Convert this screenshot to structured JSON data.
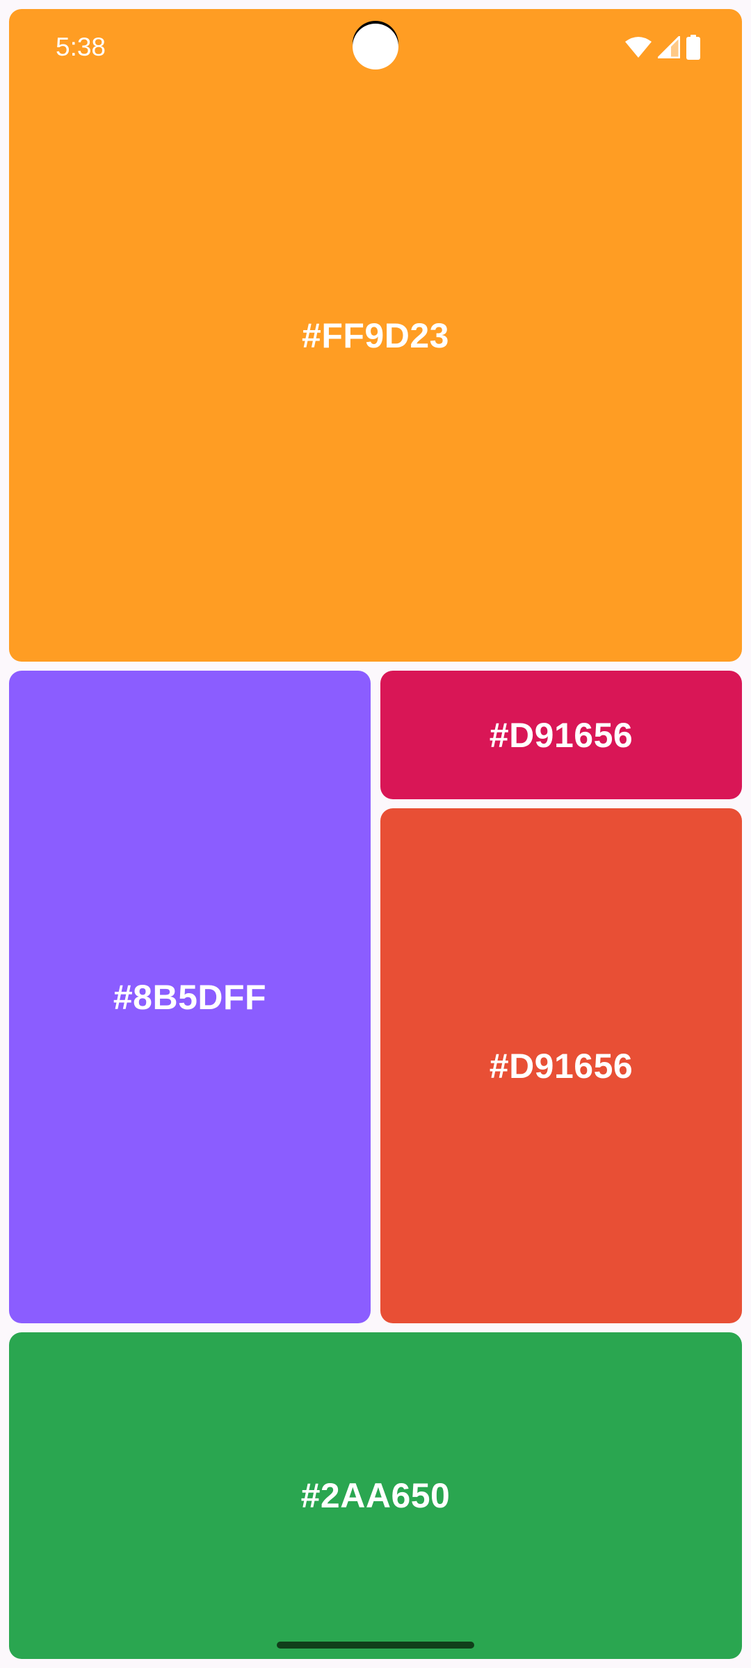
{
  "status_bar": {
    "time": "5:38",
    "icons": [
      "wifi-icon",
      "cellular-signal-icon",
      "battery-icon"
    ]
  },
  "tiles": [
    {
      "label": "#FF9D23",
      "color": "#FF9D23"
    },
    {
      "label": "#8B5DFF",
      "color": "#8B5DFF"
    },
    {
      "label": "#D91656",
      "color": "#D91656"
    },
    {
      "label": "#D91656",
      "color": "#E84F35"
    },
    {
      "label": "#2AA650",
      "color": "#2AA650"
    }
  ],
  "colors": {
    "background": "#FCF8FC",
    "gesture_bar": "#103E1A"
  }
}
